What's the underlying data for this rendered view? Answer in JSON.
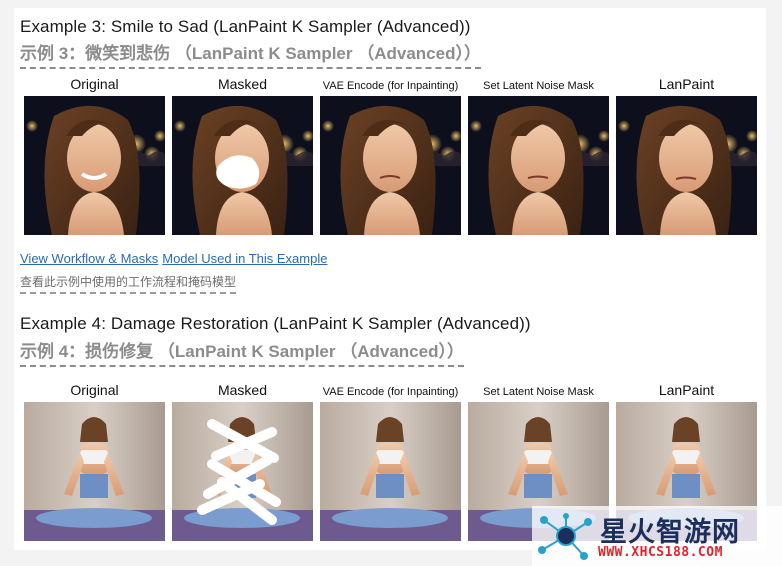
{
  "example3": {
    "title_en": "Example 3: Smile to Sad (LanPaint K Sampler (Advanced))",
    "title_cn": "示例 3：微笑到悲伤 （LanPaint K Sampler （Advanced））",
    "images": [
      {
        "caption": "Original"
      },
      {
        "caption": "Masked"
      },
      {
        "caption": "VAE Encode (for Inpainting)"
      },
      {
        "caption": "Set Latent Noise Mask"
      },
      {
        "caption": "LanPaint"
      }
    ],
    "link_workflow": "View Workflow & Masks",
    "link_model": "Model Used in This Example",
    "note_cn": "查看此示例中使用的工作流程和掩码模型"
  },
  "example4": {
    "title_en": "Example 4: Damage Restoration (LanPaint K Sampler (Advanced))",
    "title_cn": "示例 4：损伤修复 （LanPaint K Sampler （Advanced））",
    "images": [
      {
        "caption": "Original"
      },
      {
        "caption": "Masked"
      },
      {
        "caption": "VAE Encode (for Inpainting)"
      },
      {
        "caption": "Set Latent Noise Mask"
      },
      {
        "caption": "LanPaint"
      }
    ]
  },
  "watermark": {
    "title": "星火智游网",
    "url": "WWW.XHCS188.COM",
    "accent": "#e3232b",
    "brand": "#1c2e5c"
  }
}
